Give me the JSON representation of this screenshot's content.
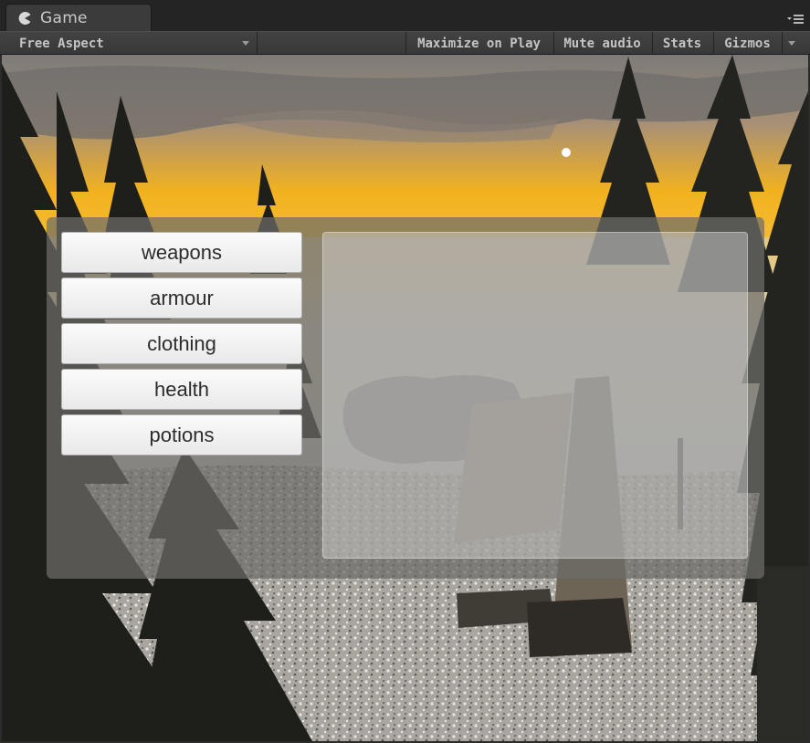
{
  "window": {
    "tab_label": "Game",
    "tab_icon": "pacman-icon",
    "menu_icon": "panel-menu-icon"
  },
  "toolbar": {
    "aspect_label": "Free Aspect",
    "maximize_label": "Maximize on Play",
    "mute_label": "Mute audio",
    "stats_label": "Stats",
    "gizmos_label": "Gizmos"
  },
  "game_ui": {
    "categories": [
      {
        "label": "weapons"
      },
      {
        "label": "armour"
      },
      {
        "label": "clothing"
      },
      {
        "label": "health"
      },
      {
        "label": "potions"
      }
    ]
  },
  "colors": {
    "editor_background": "#242424",
    "toolbar_text": "#c4c4c4",
    "button_face": "#f4f4f4",
    "panel_overlay": "#6e6c6a",
    "sky_accent": "#f2b21f"
  }
}
